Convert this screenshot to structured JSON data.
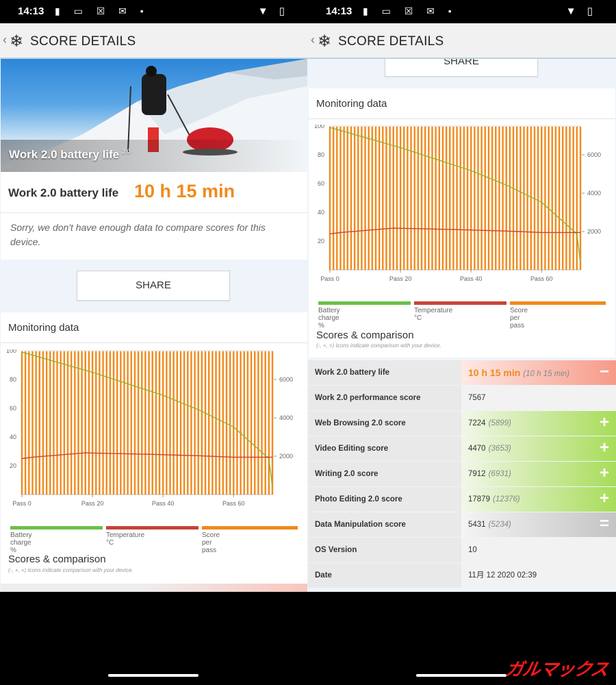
{
  "status_bar": {
    "time": "14:13"
  },
  "app_bar": {
    "title": "SCORE DETAILS"
  },
  "hero": {
    "caption": "Work 2.0 battery life",
    "caption_sup": "2.0"
  },
  "result": {
    "label": "Work 2.0 battery life",
    "value": "10 h 15 min"
  },
  "notice": "Sorry, we don't have enough data to compare scores for this device.",
  "share_label": "SHARE",
  "monitoring": {
    "title": "Monitoring data",
    "left_ticks": [
      "100",
      "80",
      "60",
      "40",
      "20"
    ],
    "right_ticks": [
      "6000",
      "4000",
      "2000"
    ],
    "x_ticks": [
      "Pass 0",
      "Pass 20",
      "Pass 40",
      "Pass 60"
    ],
    "legend": [
      {
        "label": "Battery charge %",
        "color": "#6cc04a"
      },
      {
        "label": "Temperature °C",
        "color": "#c8423a"
      },
      {
        "label": "Score per pass",
        "color": "#f08a1c"
      }
    ]
  },
  "chart_data": {
    "type": "line",
    "xlabel": "",
    "ylabel": "",
    "x_range": [
      0,
      71
    ],
    "y_left_range": [
      0,
      100
    ],
    "y_right_range": [
      0,
      7500
    ],
    "series": [
      {
        "name": "Battery charge %",
        "axis": "left",
        "points": [
          [
            0,
            99
          ],
          [
            10,
            92
          ],
          [
            20,
            85
          ],
          [
            30,
            77
          ],
          [
            40,
            69
          ],
          [
            50,
            59
          ],
          [
            60,
            47
          ],
          [
            70,
            25
          ],
          [
            71,
            5
          ]
        ]
      },
      {
        "name": "Temperature °C",
        "axis": "left",
        "points": [
          [
            0,
            25
          ],
          [
            3,
            26
          ],
          [
            8,
            27
          ],
          [
            18,
            29
          ],
          [
            36,
            28
          ],
          [
            50,
            27
          ],
          [
            60,
            26
          ],
          [
            70,
            26
          ],
          [
            71,
            26
          ]
        ]
      },
      {
        "name": "Score per pass",
        "axis": "right",
        "value_each_pass": 7470,
        "passes": 71
      }
    ]
  },
  "scores": {
    "title": "Scores & comparison",
    "subtitle": "(-, +, =) Icons indicate comparison with your device.",
    "rows": [
      {
        "name": "Work 2.0 battery life",
        "value": "10 h 15 min",
        "compare": "(10 h 15 min)",
        "indicator": "−"
      },
      {
        "name": "Work 2.0 performance score",
        "value": "7567",
        "compare": "",
        "indicator": ""
      },
      {
        "name": "Web Browsing 2.0 score",
        "value": "7224",
        "compare": "(5899)",
        "indicator": "+"
      },
      {
        "name": "Video Editing score",
        "value": "4470",
        "compare": "(3653)",
        "indicator": "+"
      },
      {
        "name": "Writing 2.0 score",
        "value": "7912",
        "compare": "(6931)",
        "indicator": "+"
      },
      {
        "name": "Photo Editing 2.0 score",
        "value": "17879",
        "compare": "(12376)",
        "indicator": "+"
      },
      {
        "name": "Data Manipulation score",
        "value": "5431",
        "compare": "(5234)",
        "indicator": "="
      },
      {
        "name": "OS Version",
        "value": "10",
        "compare": "",
        "indicator": ""
      },
      {
        "name": "Date",
        "value": "11月 12 2020 02:39",
        "compare": "",
        "indicator": ""
      }
    ]
  },
  "watermark": "ガルマックス"
}
